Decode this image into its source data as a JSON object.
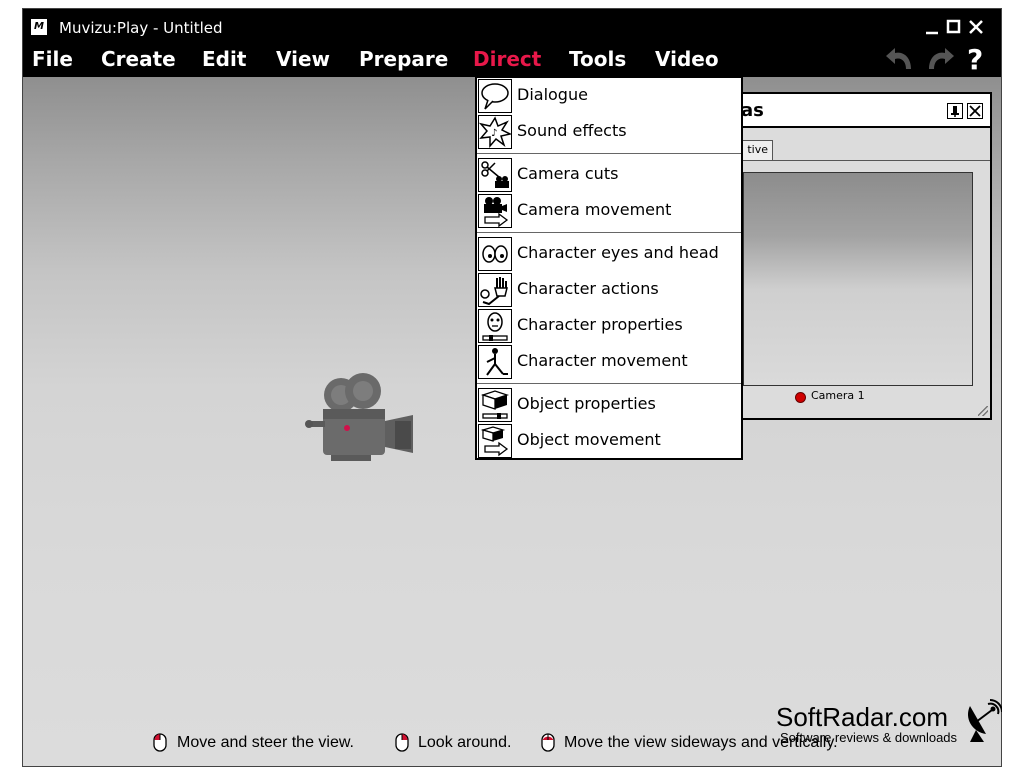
{
  "window": {
    "title": "Muvizu:Play - Untitled",
    "app_icon_text": "M"
  },
  "menubar": {
    "items": [
      {
        "label": "File"
      },
      {
        "label": "Create"
      },
      {
        "label": "Edit"
      },
      {
        "label": "View"
      },
      {
        "label": "Prepare"
      },
      {
        "label": "Direct",
        "active": true
      },
      {
        "label": "Tools"
      },
      {
        "label": "Video"
      }
    ],
    "active_color": "#e8184a",
    "help_label": "?"
  },
  "direct_menu": {
    "groups": [
      [
        {
          "label": "Dialogue",
          "icon": "speech-bubble-icon"
        },
        {
          "label": "Sound effects",
          "icon": "sound-burst-icon"
        }
      ],
      [
        {
          "label": "Camera cuts",
          "icon": "scissors-camera-icon"
        },
        {
          "label": "Camera movement",
          "icon": "camera-arrow-icon"
        }
      ],
      [
        {
          "label": "Character eyes and head",
          "icon": "eyes-icon"
        },
        {
          "label": "Character actions",
          "icon": "waving-hand-icon"
        },
        {
          "label": "Character properties",
          "icon": "character-head-icon"
        },
        {
          "label": "Character movement",
          "icon": "walking-figure-icon"
        }
      ],
      [
        {
          "label": "Object properties",
          "icon": "object-slider-icon"
        },
        {
          "label": "Object movement",
          "icon": "object-arrow-icon"
        }
      ]
    ]
  },
  "cameras_panel": {
    "title_visible": "as",
    "tab_visible": "tive",
    "camera_label": "Camera 1",
    "camera_dot_color": "#d00000"
  },
  "status_hints": [
    {
      "text": "Move and steer the view."
    },
    {
      "text": "Look around."
    },
    {
      "text": "Move the view sideways and vertically."
    }
  ],
  "watermark": {
    "title": "SoftRadar.com",
    "subtitle": "Software reviews & downloads"
  }
}
